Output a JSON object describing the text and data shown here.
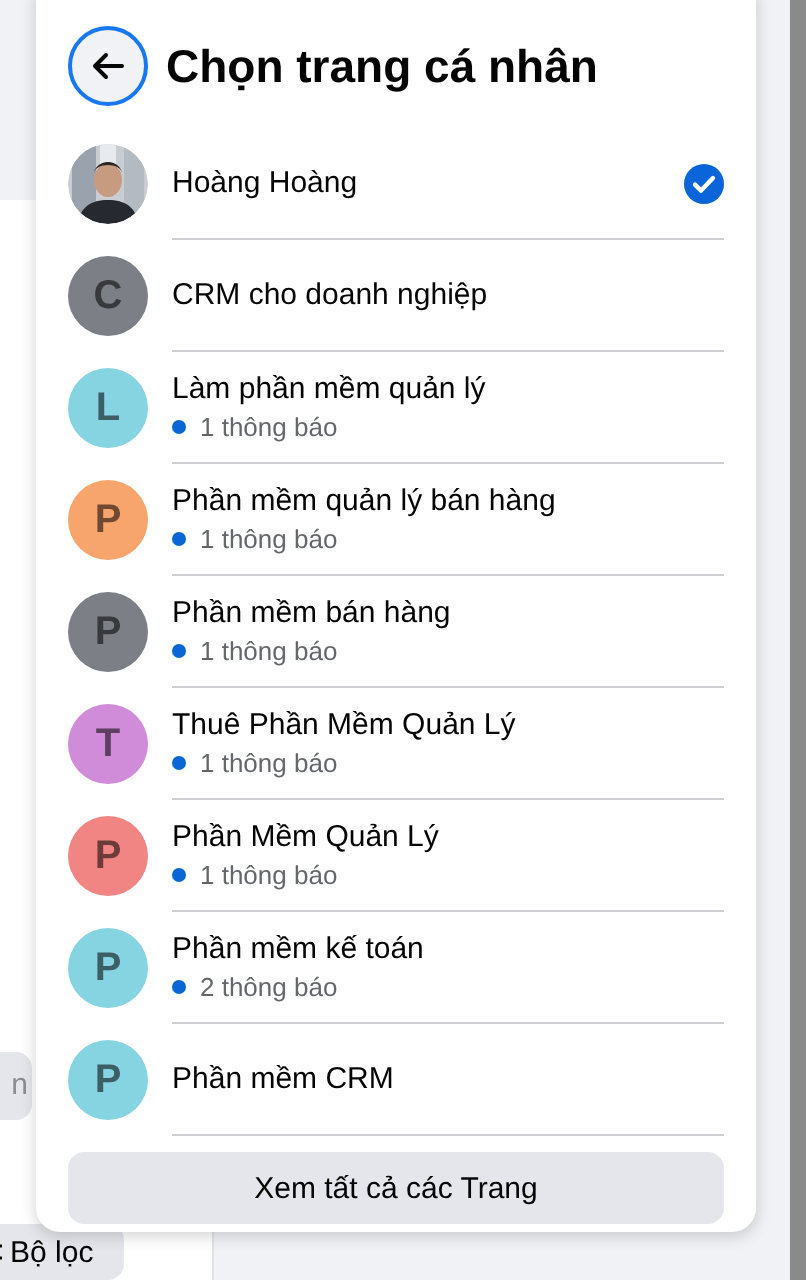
{
  "background": {
    "chip": "n",
    "filter_button": "Bộ lọc"
  },
  "dialog": {
    "title": "Chọn trang cá nhân",
    "profiles": [
      {
        "name": "Hoàng Hoàng",
        "selected": true
      },
      {
        "name": "CRM cho doanh nghiệp",
        "kind": "letter",
        "letter": "C",
        "color": "#7c7f86",
        "selected": false
      },
      {
        "name": "Làm phần mềm quản lý",
        "kind": "letter",
        "letter": "L",
        "color": "#86d3e2",
        "notifications": "1 thông báo",
        "selected": false
      },
      {
        "name": "Phần mềm quản lý bán hàng",
        "kind": "letter",
        "letter": "P",
        "color": "#f7a56d",
        "notifications": "1 thông báo",
        "selected": false
      },
      {
        "name": "Phần mềm bán hàng",
        "kind": "letter",
        "letter": "P",
        "color": "#7c7f86",
        "notifications": "1 thông báo",
        "selected": false
      },
      {
        "name": "Thuê Phần Mềm Quản Lý",
        "kind": "letter",
        "letter": "T",
        "color": "#d08cd9",
        "notifications": "1 thông báo",
        "selected": false
      },
      {
        "name": "Phần Mềm Quản Lý",
        "kind": "letter",
        "letter": "P",
        "color": "#f18584",
        "notifications": "1 thông báo",
        "selected": false
      },
      {
        "name": "Phần mềm kế toán",
        "kind": "letter",
        "letter": "P",
        "color": "#86d3e2",
        "notifications": "2 thông báo",
        "selected": false
      },
      {
        "name": "Phần mềm CRM",
        "kind": "letter",
        "letter": "P",
        "color": "#86d3e2",
        "selected": false
      }
    ],
    "see_all": "Xem tất cả các Trang"
  }
}
